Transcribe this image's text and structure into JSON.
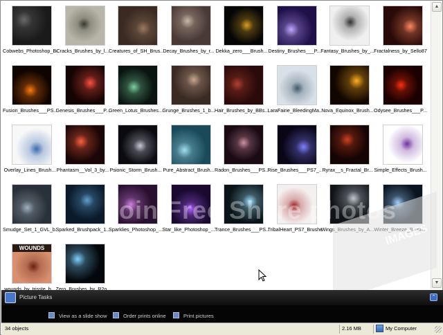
{
  "items": [
    {
      "label": "Cobwebs_Photoshop_Brushes_by_redheadstock",
      "wrap": true,
      "bg": "#1a1a1a",
      "accent": "#6a6a6a"
    },
    {
      "label": "Cracks_Brushes_by_l...",
      "bg": "#b8b6a8",
      "accent": "#3a3a30"
    },
    {
      "label": "Creatures_of_SH_Brus...",
      "bg": "#3a2a22",
      "accent": "#9a7a62"
    },
    {
      "label": "Decay_Brushes_by_r...",
      "bg": "#4a3a36",
      "accent": "#c8b8a8"
    },
    {
      "label": "Dekka_zero___Brush...",
      "bg": "#060606",
      "accent": "#d8a020"
    },
    {
      "label": "Destiny_Brushes___P...",
      "bg": "#20104a",
      "accent": "#c0a8ff"
    },
    {
      "label": "Fantasy_Brushes_by_...",
      "bg": "#f0f0f0",
      "accent": "#303030"
    },
    {
      "label": "Fractalness_by_Sello87",
      "bg": "#2a0a08",
      "accent": "#ff8860"
    },
    {
      "label": "Fusion_Brushes___PS...",
      "bg": "#100400",
      "accent": "#ff7a10"
    },
    {
      "label": "Genesis_Brushes___P...",
      "bg": "#140404",
      "accent": "#ff5040"
    },
    {
      "label": "Green_Lotus_Brushes...",
      "bg": "#0a1410",
      "accent": "#7ad0a0"
    },
    {
      "label": "Grunge_Brushes_1_b...",
      "bg": "#3a2a24",
      "accent": "#c8a890"
    },
    {
      "label": "Hair_Brushes_by_BBs...",
      "bg": "#2a0a0a",
      "accent": "#b04030"
    },
    {
      "label": "LaraFairie_BleedingMa...",
      "bg": "#d8e0e8",
      "accent": "#405868"
    },
    {
      "label": "Nova_Equinox_Brush...",
      "bg": "#120600",
      "accent": "#ffb020"
    },
    {
      "label": "Odysee_Brushes___P...",
      "bg": "#1a0000",
      "accent": "#ff3010"
    },
    {
      "label": "Overlay_Lines_Brush...",
      "bg": "#f8f8f8",
      "accent": "#3a6ab0"
    },
    {
      "label": "Phantasm__Vol_3_by...",
      "bg": "#1a0606",
      "accent": "#ff6040"
    },
    {
      "label": "Psionic_Storm_Brush...",
      "bg": "#0a0a10",
      "accent": "#c8c8d8"
    },
    {
      "label": "Pure_Abstract_Brush...",
      "bg": "#1a4a5a",
      "accent": "#a0e0f0"
    },
    {
      "label": "Radon_Brushes___PS...",
      "bg": "#1a0a14",
      "accent": "#d090a0"
    },
    {
      "label": "Rise_Brushes___PS7_...",
      "bg": "#0a0618",
      "accent": "#8080ff"
    },
    {
      "label": "Ryrax__s_Fractal_Br...",
      "bg": "#140404",
      "accent": "#d04020"
    },
    {
      "label": "Simple_Effects_Brush...",
      "bg": "#ffffff",
      "accent": "#7030a0"
    },
    {
      "label": "Smudge_Set_1_GVL_b...",
      "bg": "#2a3038",
      "accent": "#a0b0c0"
    },
    {
      "label": "Sparked_Brushpack_1...",
      "bg": "#0a1a2a",
      "accent": "#60a0d0"
    },
    {
      "label": "Sparklies_Photoshop_...",
      "bg": "#2a1030",
      "accent": "#d080e0"
    },
    {
      "label": "Star_like_Photoshop_...",
      "bg": "#1a0a30",
      "accent": "#b060ff"
    },
    {
      "label": "Trance_Brushes___PS...",
      "bg": "#0a1418",
      "accent": "#a0e0ff"
    },
    {
      "label": "TribalHeart_PS7_Brushes",
      "bg": "#f4f0f0",
      "accent": "#a02020"
    },
    {
      "label": "Wings_Brushes_by_A...",
      "bg": "#101418",
      "accent": "#c0c8d0"
    },
    {
      "label": "Winter_Breeze_Brush...",
      "bg": "#0a1420",
      "accent": "#a0d0ff"
    },
    {
      "label": "wounds_by_trisste_b...",
      "bg": "#d89070",
      "accent": "#6a2010",
      "title": "WOUNDS"
    },
    {
      "label": "Zero_Brushes_by_R2o...",
      "bg": "#04080c",
      "accent": "#80d0ff"
    }
  ],
  "watermark": {
    "text": "Join Free Share photos",
    "brand": "IMAGES"
  },
  "tasks": {
    "title": "Picture Tasks",
    "links": [
      "View as a slide show",
      "Order prints online",
      "Print pictures"
    ]
  },
  "status": {
    "objects": "34 objects",
    "size": "2.16 MB",
    "location": "My Computer"
  }
}
